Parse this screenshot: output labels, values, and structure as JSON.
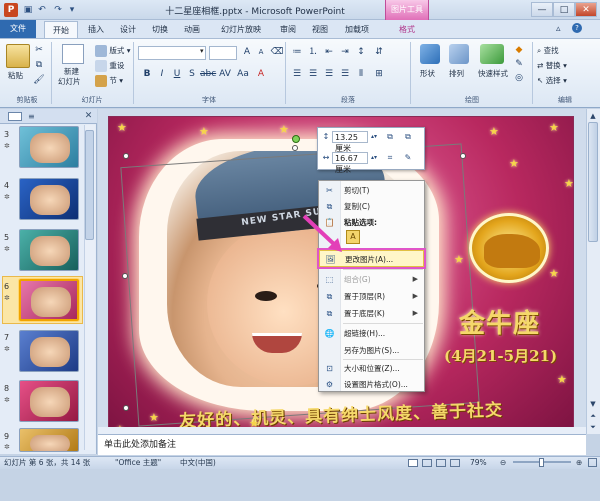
{
  "window": {
    "title": "十二星座相框.pptx - Microsoft PowerPoint",
    "context_tab_group": "图片工具",
    "app_icon": "P"
  },
  "tabs": [
    "文件",
    "开始",
    "插入",
    "设计",
    "切换",
    "动画",
    "幻灯片放映",
    "审阅",
    "视图",
    "加载项",
    "格式"
  ],
  "ribbon": {
    "clipboard": {
      "paste": "粘贴",
      "label": "剪贴板"
    },
    "slides": {
      "new_slide": "新建",
      "new_slide2": "幻灯片",
      "layout": "版式",
      "reset": "重设",
      "section": "节",
      "label": "幻灯片"
    },
    "font": {
      "label": "字体"
    },
    "paragraph": {
      "label": "段落"
    },
    "drawing": {
      "shape": "形状",
      "arrange": "排列",
      "quick_styles": "快速样式",
      "label": "绘图"
    },
    "editing": {
      "find": "查找",
      "replace": "替换",
      "select": "选择",
      "label": "编辑"
    }
  },
  "slide_pane": {
    "slides": [
      {
        "num": "3"
      },
      {
        "num": "4"
      },
      {
        "num": "5"
      },
      {
        "num": "6",
        "selected": true
      },
      {
        "num": "7"
      },
      {
        "num": "8"
      },
      {
        "num": "9"
      }
    ]
  },
  "slide": {
    "title": "金牛座",
    "dates": "(4月21-5月21)",
    "slogan": "友好的、机灵、具有绅士风度、善于社交",
    "hat_text": "NEW STAR SUPER"
  },
  "mini_toolbar": {
    "height": "13.25 厘米",
    "width": "16.67 厘米"
  },
  "context_menu": {
    "items": [
      {
        "label": "剪切(T)",
        "icon": "scissors-icon"
      },
      {
        "label": "复制(C)",
        "icon": "copy-icon"
      },
      {
        "label": "粘贴选项:",
        "icon": "paste-options-icon"
      },
      {
        "label": "更改图片(A)...",
        "icon": "change-picture-icon"
      },
      {
        "label": "组合(G)",
        "icon": "group-icon"
      },
      {
        "label": "置于顶层(R)",
        "icon": "bring-front-icon"
      },
      {
        "label": "置于底层(K)",
        "icon": "send-back-icon"
      },
      {
        "label": "超链接(H)...",
        "icon": "hyperlink-icon"
      },
      {
        "label": "另存为图片(S)...",
        "icon": ""
      },
      {
        "label": "大小和位置(Z)...",
        "icon": "size-position-icon"
      },
      {
        "label": "设置图片格式(O)...",
        "icon": "format-picture-icon"
      }
    ]
  },
  "notes": {
    "placeholder": "单击此处添加备注"
  },
  "status": {
    "slide_info": "幻灯片 第 6 张，共 14 张",
    "theme": "\"Office 主题\"",
    "language": "中文(中国)",
    "zoom": "79%"
  },
  "colors": {
    "accent": "#2f6ab0",
    "picture_tools": "#e070b8",
    "slide_bg": "#b8285f"
  }
}
